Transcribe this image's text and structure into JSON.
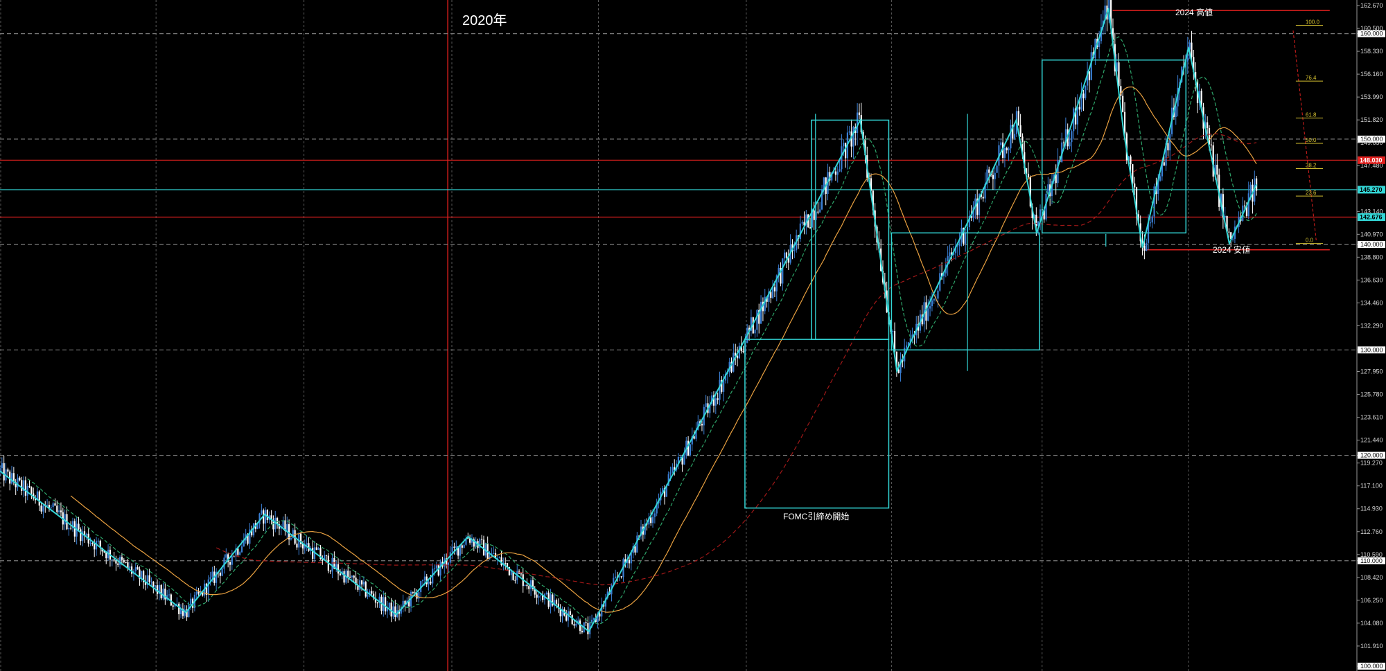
{
  "chart_data": {
    "type": "candlestick",
    "y_scale": {
      "min": 100.0,
      "max": 162.67
    },
    "x_scale": {
      "min": 0,
      "max": 100
    },
    "colors": {
      "background": "#000000",
      "bull_candle": "#3a7fd5",
      "bear_candle": "#ffffff",
      "grid": "#5a5a5a",
      "wave_lines": "#33d6d6",
      "red_lines": "#e0201e",
      "sma_fast": "#2ea56a",
      "sma_mid": "#e8a040",
      "sma_slow": "#a01818",
      "fib": "#d4c030"
    },
    "y_ticks": [
      {
        "value": 162.67,
        "label": "162.670"
      },
      {
        "value": 160.5,
        "label": "160.500"
      },
      {
        "value": 160.0,
        "label": "160.000",
        "badge": true
      },
      {
        "value": 158.33,
        "label": "158.330"
      },
      {
        "value": 156.16,
        "label": "156.160"
      },
      {
        "value": 153.99,
        "label": "153.990"
      },
      {
        "value": 151.82,
        "label": "151.820"
      },
      {
        "value": 150.0,
        "label": "150.000",
        "badge": true
      },
      {
        "value": 149.65,
        "label": "149.650"
      },
      {
        "value": 147.48,
        "label": "147.480"
      },
      {
        "value": 143.14,
        "label": "143.140"
      },
      {
        "value": 140.97,
        "label": "140.970"
      },
      {
        "value": 140.0,
        "label": "140.000",
        "badge": true
      },
      {
        "value": 138.8,
        "label": "138.800"
      },
      {
        "value": 136.63,
        "label": "136.630"
      },
      {
        "value": 134.46,
        "label": "134.460"
      },
      {
        "value": 132.29,
        "label": "132.290"
      },
      {
        "value": 130.0,
        "label": "130.000",
        "badge": true
      },
      {
        "value": 127.95,
        "label": "127.950"
      },
      {
        "value": 125.78,
        "label": "125.780"
      },
      {
        "value": 123.61,
        "label": "123.610"
      },
      {
        "value": 121.44,
        "label": "121.440"
      },
      {
        "value": 120.0,
        "label": "120.000",
        "badge": true
      },
      {
        "value": 119.27,
        "label": "119.270"
      },
      {
        "value": 117.1,
        "label": "117.100"
      },
      {
        "value": 114.93,
        "label": "114.930"
      },
      {
        "value": 112.76,
        "label": "112.760"
      },
      {
        "value": 110.59,
        "label": "110.590"
      },
      {
        "value": 110.0,
        "label": "110.000",
        "badge": true
      },
      {
        "value": 108.42,
        "label": "108.420"
      },
      {
        "value": 106.25,
        "label": "106.250"
      },
      {
        "value": 104.08,
        "label": "104.080"
      },
      {
        "value": 101.91,
        "label": "101.910"
      },
      {
        "value": 100.0,
        "label": "100.000",
        "badge": true
      }
    ],
    "price_badges": [
      {
        "value": 148.0,
        "label": "148.030",
        "bg": "#e0201e",
        "fg": "#ffffff"
      },
      {
        "value": 145.2,
        "label": "145.270",
        "bg": "#33d6d6",
        "fg": "#000000"
      },
      {
        "value": 142.6,
        "label": "142.676",
        "bg": "#33d6d6",
        "fg": "#000000"
      }
    ],
    "horizontal_lines": [
      {
        "value": 160.0,
        "style": "dashed",
        "color": "#7a7a7a"
      },
      {
        "value": 150.0,
        "style": "dashed",
        "color": "#7a7a7a"
      },
      {
        "value": 140.0,
        "style": "dashed",
        "color": "#7a7a7a"
      },
      {
        "value": 130.0,
        "style": "dashed",
        "color": "#7a7a7a"
      },
      {
        "value": 120.0,
        "style": "dashed",
        "color": "#7a7a7a"
      },
      {
        "value": 110.0,
        "style": "dashed",
        "color": "#7a7a7a"
      },
      {
        "value": 148.0,
        "style": "solid",
        "color": "#e0201e"
      },
      {
        "value": 145.2,
        "style": "solid",
        "color": "#33d6d6"
      },
      {
        "value": 142.6,
        "style": "solid",
        "color": "#e0201e"
      }
    ],
    "vertical_grid_x": [
      11.5,
      22.4,
      33.3,
      44.1,
      55.0,
      65.7,
      76.8,
      87.6
    ],
    "vertical_marker": {
      "x": 33.0,
      "label": "2020年"
    },
    "annotations": [
      {
        "x": 87.3,
        "y": 161.9,
        "label": "2024 高値"
      },
      {
        "x": 90.6,
        "y": 138.6,
        "label": "2024 安値"
      },
      {
        "x": 60.5,
        "y": 114.4,
        "label": "FOMC引締め開始"
      }
    ],
    "red_segments": [
      {
        "x1": 82.0,
        "y1": 162.2,
        "x2": 98.0,
        "y2": 162.2
      },
      {
        "x1": 84.3,
        "y1": 139.5,
        "x2": 98.0,
        "y2": 139.5
      }
    ],
    "wave_polyline": [
      [
        0.0,
        118.5
      ],
      [
        13.7,
        105.1
      ],
      [
        19.5,
        114.4
      ],
      [
        29.2,
        104.9
      ],
      [
        34.5,
        112.3
      ],
      [
        43.4,
        103.3
      ],
      [
        54.9,
        131.0
      ],
      [
        63.4,
        151.8
      ],
      [
        66.1,
        128.0
      ],
      [
        74.9,
        151.8
      ],
      [
        76.4,
        141.1
      ],
      [
        81.7,
        162.4
      ],
      [
        82.8,
        150.8
      ],
      [
        84.2,
        139.7
      ],
      [
        87.6,
        158.7
      ],
      [
        90.6,
        140.1
      ],
      [
        92.6,
        145.7
      ]
    ],
    "wave_boxes": [
      {
        "x1": 54.9,
        "y1": 131.0,
        "x2": 65.5,
        "y2": 115.0
      },
      {
        "x1": 59.8,
        "y1": 151.8,
        "x2": 65.5,
        "y2": 131.0
      },
      {
        "x1": 65.7,
        "y1": 141.1,
        "x2": 76.6,
        "y2": 130.0
      },
      {
        "x1": 76.8,
        "y1": 157.5,
        "x2": 87.4,
        "y2": 141.1
      }
    ],
    "wave_vlines": [
      {
        "x": 60.1,
        "y1": 152.4,
        "y2": 131.0
      },
      {
        "x": 71.3,
        "y1": 152.4,
        "y2": 128.0
      },
      {
        "x": 81.5,
        "y1": 141.0,
        "y2": 139.8
      }
    ],
    "fib_levels": [
      {
        "value": 160.8,
        "label": "100.0"
      },
      {
        "value": 155.5,
        "label": "76.4"
      },
      {
        "value": 152.0,
        "label": "61.8"
      },
      {
        "value": 149.6,
        "label": "50.0"
      },
      {
        "value": 147.2,
        "label": "38.2"
      },
      {
        "value": 144.6,
        "label": "23.6"
      },
      {
        "value": 140.1,
        "label": "0.0"
      }
    ],
    "fib_x": {
      "x1": 95.5,
      "x2": 97.5
    },
    "fib_diagonal": {
      "x1": 95.3,
      "y1": 160.3,
      "x2": 97.0,
      "y2": 140.4
    }
  }
}
